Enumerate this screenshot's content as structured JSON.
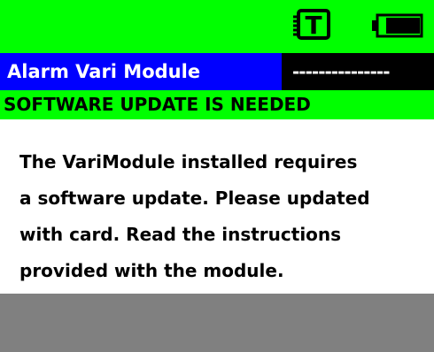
{
  "status": {
    "icons": [
      "card-t-icon",
      "battery-icon"
    ],
    "card_icon_letter": "T"
  },
  "title": {
    "label": "Alarm Vari Module",
    "value": "---------------"
  },
  "alert": {
    "text": "SOFTWARE UPDATE IS NEEDED"
  },
  "message": {
    "lines": [
      "The VariModule installed requires",
      "a software update. Please updated",
      "with card. Read the instructions",
      "provided with the module."
    ]
  },
  "colors": {
    "status_bg": "#00ff00",
    "title_bg": "#0000ff",
    "value_bg": "#000000",
    "bottom_bar": "#808080"
  }
}
